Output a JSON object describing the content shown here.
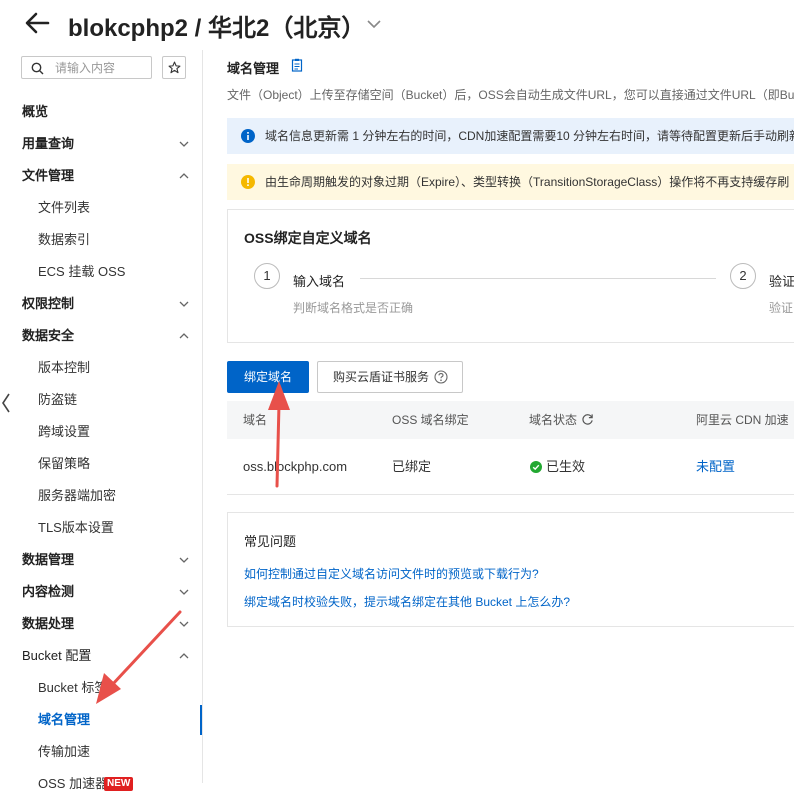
{
  "header": {
    "title": "blokcphp2 / 华北2（北京）"
  },
  "sidebar": {
    "search_placeholder": "请输入内容",
    "items": [
      {
        "label": "概览"
      },
      {
        "label": "用量查询"
      },
      {
        "label": "文件管理"
      },
      {
        "label": "文件列表"
      },
      {
        "label": "数据索引"
      },
      {
        "label": "ECS 挂载 OSS"
      },
      {
        "label": "权限控制"
      },
      {
        "label": "数据安全"
      },
      {
        "label": "版本控制"
      },
      {
        "label": "防盗链"
      },
      {
        "label": "跨域设置"
      },
      {
        "label": "保留策略"
      },
      {
        "label": "服务器端加密"
      },
      {
        "label": "TLS版本设置"
      },
      {
        "label": "数据管理"
      },
      {
        "label": "内容检测"
      },
      {
        "label": "数据处理"
      },
      {
        "label": "Bucket 配置"
      },
      {
        "label": "Bucket 标签"
      },
      {
        "label": "域名管理"
      },
      {
        "label": "传输加速"
      },
      {
        "label": "OSS 加速器",
        "badge": "NEW"
      }
    ]
  },
  "main": {
    "section_title": "域名管理",
    "description": "文件（Object）上传至存储空间（Bucket）后，OSS会自动生成文件URL，您可以直接通过文件URL（即Bu",
    "alert_info": "域名信息更新需 1 分钟左右的时间，CDN加速配置需要10 分钟左右时间，请等待配置更新后手动刷新",
    "alert_warning": "由生命周期触发的对象过期（Expire）、类型转换（TransitionStorageClass）操作将不再支持缓存刷",
    "bind_card": {
      "title": "OSS绑定自定义域名",
      "steps": [
        {
          "number": "1",
          "title": "输入域名",
          "desc": "判断域名格式是否正确"
        },
        {
          "number": "2",
          "title": "验证",
          "desc": "验证"
        }
      ]
    },
    "buttons": {
      "bind": "绑定域名",
      "buy_cert": "购买云盾证书服务"
    },
    "table": {
      "headers": [
        "域名",
        "OSS 域名绑定",
        "域名状态",
        "阿里云 CDN 加速（"
      ],
      "rows": [
        {
          "domain": "oss.blockphp.com",
          "bind": "已绑定",
          "status": "已生效",
          "cdn": "未配置"
        }
      ]
    },
    "faq": {
      "title": "常见问题",
      "links": [
        "如何控制通过自定义域名访问文件时的预览或下载行为?",
        "绑定域名时校验失败，提示域名绑定在其他 Bucket 上怎么办?"
      ]
    }
  },
  "colors": {
    "accent": "#0064c8",
    "success": "#22a831",
    "warning": "#f5b800",
    "annotation": "#e8504a"
  }
}
